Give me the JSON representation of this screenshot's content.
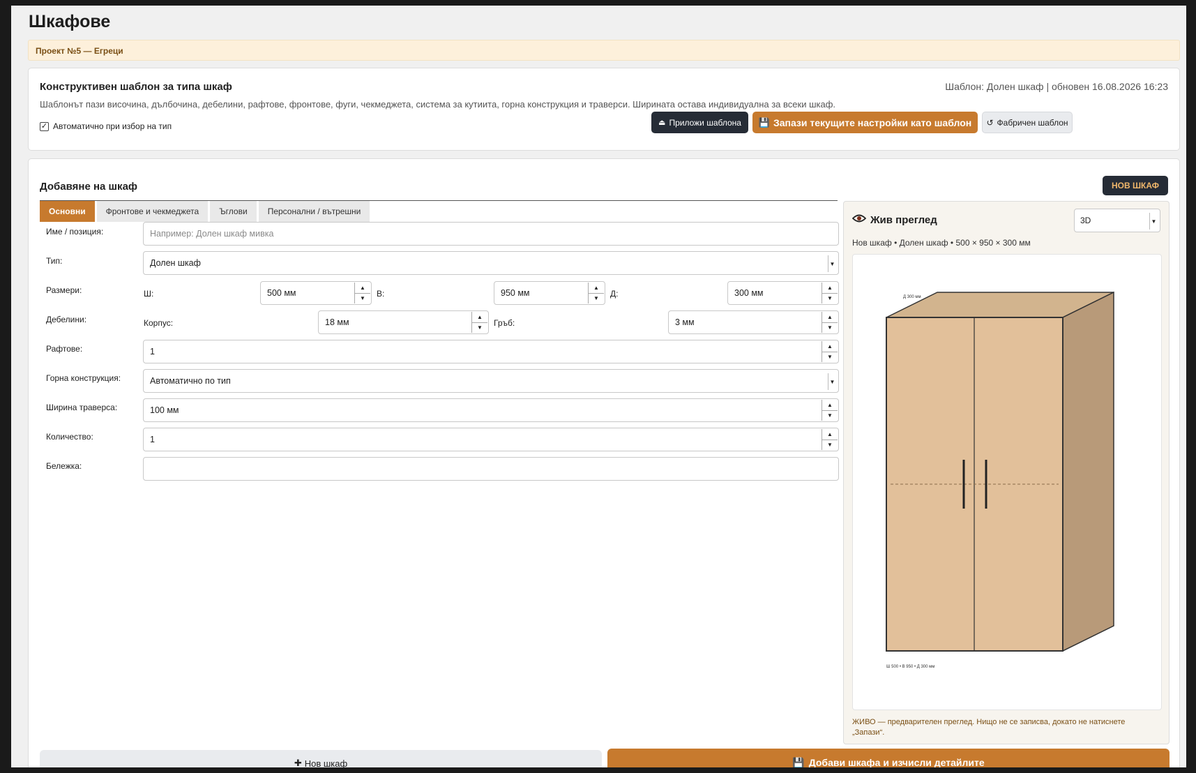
{
  "page": {
    "title": "Шкафове",
    "project": "Проект №5 — Егреци"
  },
  "template": {
    "title": "Конструктивен шаблон за типа шкаф",
    "meta": "Шаблон: Долен шкаф | обновен 16.08.2026 16:23",
    "description": "Шаблонът пази височина, дълбочина, дебелини, рафтове, фронтове, фуги, чекмеджета, система за кутиита, горна конструкция и траверси. Ширината остава индивидуална за всеки шкаф.",
    "auto_label": "Автоматично при избор на тип",
    "auto_checked": true,
    "apply_label": "Приложи шаблона",
    "save_label": "Запази текущите настройки като шаблон",
    "factory_label": "Фабричен шаблон"
  },
  "add": {
    "title": "Добавяне на шкаф",
    "new_badge": "НОВ ШКАФ",
    "tabs": [
      {
        "label": "Основни",
        "active": true
      },
      {
        "label": "Фронтове и чекмеджета",
        "active": false
      },
      {
        "label": "Ъглови",
        "active": false
      },
      {
        "label": "Персонални / вътрешни",
        "active": false
      }
    ],
    "fields": {
      "name": {
        "label": "Име / позиция:",
        "placeholder": "Например: Долен шкаф мивка",
        "value": ""
      },
      "type": {
        "label": "Тип:",
        "value": "Долен шкаф"
      },
      "dims": {
        "label": "Размери:",
        "w_label": "Ш:",
        "w": "500 мм",
        "h_label": "В:",
        "h": "950 мм",
        "d_label": "Д:",
        "d": "300 мм"
      },
      "thick": {
        "label": "Дебелини:",
        "body_label": "Корпус:",
        "body": "18 мм",
        "back_label": "Гръб:",
        "back": "3 мм"
      },
      "shelves": {
        "label": "Рафтове:",
        "value": "1"
      },
      "top": {
        "label": "Горна конструкция:",
        "value": "Автоматично по тип"
      },
      "rail": {
        "label": "Ширина траверса:",
        "value": "100 мм"
      },
      "qty": {
        "label": "Количество:",
        "value": "1"
      },
      "note": {
        "label": "Бележка:",
        "value": ""
      }
    },
    "preview": {
      "title": "Жив преглед",
      "view": "3D",
      "subtitle": "Нов шкаф • Долен шкаф • 500 × 950 × 300 мм",
      "depth_label": "Д 300 мм",
      "dims_label": "Ш 500 • В 950 • Д 300 мм",
      "note": "ЖИВО — предварителен преглед. Нищо не се записва, докато не натиснете „Запази“."
    },
    "new_button": "Нов шкаф",
    "add_button": "Добави шкафа и изчисли детайлите"
  },
  "colors": {
    "accent": "#c77a2e",
    "dark": "#262c36",
    "cabinet_front": "#e2c09a",
    "cabinet_side": "#b89a79",
    "cabinet_top": "#d2b48e"
  }
}
